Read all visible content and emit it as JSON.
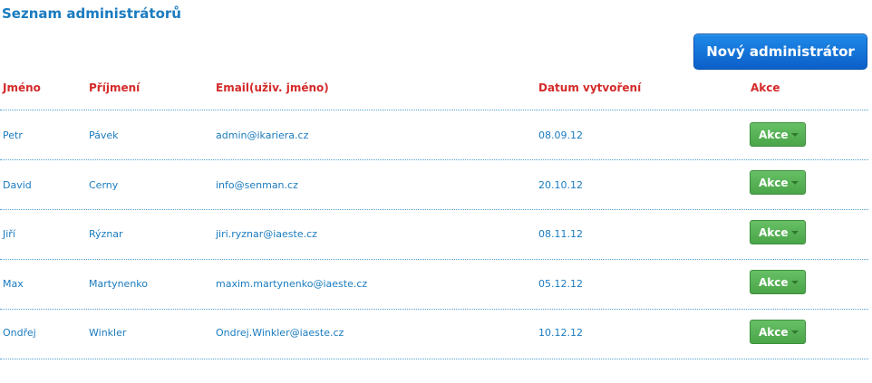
{
  "page": {
    "title": "Seznam administrátorů",
    "new_button_label": "Nový administrátor"
  },
  "table": {
    "columns": [
      "Jméno",
      "Příjmení",
      "Email(uživ. jméno)",
      "Datum vytvoření",
      "Akce"
    ],
    "rows": [
      {
        "first_name": "Petr",
        "last_name": "Pávek",
        "email": "admin@ikariera.cz",
        "created": "08.09.12",
        "action": "Akce"
      },
      {
        "first_name": "David",
        "last_name": "Cerny",
        "email": "info@senman.cz",
        "created": "20.10.12",
        "action": "Akce"
      },
      {
        "first_name": "Jiří",
        "last_name": "Rýznar",
        "email": "jiri.ryznar@iaeste.cz",
        "created": "08.11.12",
        "action": "Akce"
      },
      {
        "first_name": "Max",
        "last_name": "Martynenko",
        "email": "maxim.martynenko@iaeste.cz",
        "created": "05.12.12",
        "action": "Akce"
      },
      {
        "first_name": "Ondřej",
        "last_name": "Winkler",
        "email": "Ondrej.Winkler@iaeste.cz",
        "created": "10.12.12",
        "action": "Akce"
      }
    ]
  },
  "icons": {
    "dropdown_caret": "caret-down-icon"
  },
  "colors": {
    "title": "#1a7bbf",
    "header_text": "#d42a2a",
    "cell_text": "#1a7bbf",
    "primary_button": "#0b5fc9",
    "action_button": "#4aa448",
    "row_divider": "#4f9fd0"
  }
}
